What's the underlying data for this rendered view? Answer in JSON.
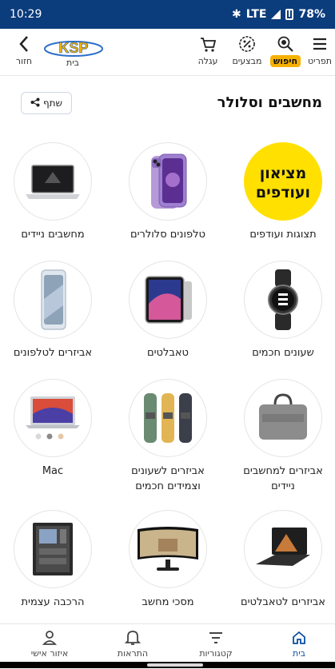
{
  "status": {
    "time": "10:29",
    "network": "LTE",
    "battery": "78%"
  },
  "topbar": {
    "back_label": "חזור",
    "home_label": "בית",
    "cart_label": "עגלה",
    "deals_label": "מבצעים",
    "search_label": "חיפוש",
    "menu_label": "תפריט",
    "logo_text": "KSP"
  },
  "page": {
    "title": "מחשבים וסלולר",
    "share_label": "שתף"
  },
  "categories": [
    {
      "label": "תצוגות ועודפים",
      "icon": "promo-icon",
      "promo_text_1": "מציאון",
      "promo_text_2": "ועודפים"
    },
    {
      "label": "טלפונים סלולרים",
      "icon": "phone-icon"
    },
    {
      "label": "מחשבים ניידים",
      "icon": "laptop-icon"
    },
    {
      "label": "שעונים חכמים",
      "icon": "smartwatch-icon"
    },
    {
      "label": "טאבלטים",
      "icon": "tablet-icon"
    },
    {
      "label": "אביזרים לטלפונים",
      "icon": "phone-accessory-icon"
    },
    {
      "label": "אביזרים למחשבים ניידים",
      "icon": "laptop-bag-icon"
    },
    {
      "label": "אביזרים לשעונים וצמידים חכמים",
      "icon": "watch-band-icon"
    },
    {
      "label": "Mac",
      "icon": "macbook-icon"
    },
    {
      "label": "אביזרים לטאבלטים",
      "icon": "tablet-keyboard-icon"
    },
    {
      "label": "מסכי מחשב",
      "icon": "monitor-icon"
    },
    {
      "label": "הרכבה עצמית",
      "icon": "pc-case-icon"
    }
  ],
  "bottom_nav": {
    "home": "בית",
    "categories": "קטגוריות",
    "alerts": "התראות",
    "account": "איזור אישי"
  },
  "colors": {
    "status_bar": "#0b3c7c",
    "accent": "#f6b100",
    "active_nav": "#0b4ea2",
    "promo_yellow": "#ffe000"
  }
}
